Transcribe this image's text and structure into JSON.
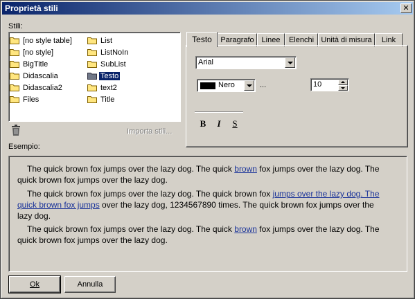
{
  "window": {
    "title": "Proprietà stili",
    "close_glyph": "✕"
  },
  "labels": {
    "styles": "Stili:",
    "example": "Esempio:",
    "import_styles": "Importa stili..."
  },
  "styles_list": {
    "col1": [
      "[no style table]",
      "[no style]",
      "BigTitle",
      "Didascalia",
      "Didascalia2",
      "Files"
    ],
    "col2": [
      "List",
      "ListNoIn",
      "SubList",
      "Testo",
      "text2",
      "Title"
    ],
    "selected": "Testo"
  },
  "tabs": [
    "Testo",
    "Paragrafo",
    "Linee",
    "Elenchi",
    "Unità di misura",
    "Link"
  ],
  "active_tab": "Testo",
  "text_tab": {
    "font": "Arial",
    "color_name": "Nero",
    "color_swatch": "#000000",
    "ellipsis": "...",
    "size": "10",
    "bold": "B",
    "italic": "I",
    "strike": "S"
  },
  "sample": {
    "p1_before": "The quick brown fox jumps over the lazy dog. The quick ",
    "p1_link": "brown",
    "p1_after": " fox jumps over the lazy dog. The quick brown fox jumps over the lazy dog.",
    "p2_before": "The quick brown fox jumps over the lazy dog. The quick brown fox ",
    "p2_link": "jumps over the lazy dog. The quick brown fox jumps",
    "p2_after": " over the lazy dog,  1234567890 times. The quick brown fox jumps over the lazy dog.",
    "p3_before": "The quick brown fox jumps over the lazy dog. The quick ",
    "p3_link": "brown",
    "p3_after": " fox jumps over the lazy dog. The quick brown fox jumps over the lazy dog.",
    "link_color": "#1a3399"
  },
  "buttons": {
    "ok": "Ok",
    "cancel": "Annulla"
  },
  "icons": {
    "folder": "folder-icon",
    "selected_folder": "folder-icon",
    "trash": "trash-icon"
  },
  "colors": {
    "title_start": "#0a246a",
    "title_end": "#a6caf0",
    "dialog_bg": "#d4d0c8",
    "selection": "#0a246a"
  }
}
